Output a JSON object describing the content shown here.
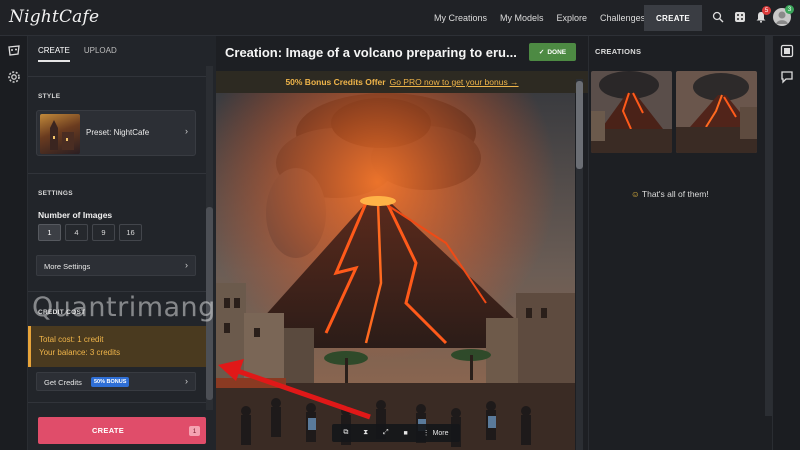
{
  "app": {
    "logo": "NightCafe"
  },
  "topnav": {
    "items": [
      "My Creations",
      "My Models",
      "Explore",
      "Challenges"
    ],
    "create_label": "CREATE",
    "notifications_badge": "5",
    "avatar_badge": "3"
  },
  "left": {
    "tabs": [
      "CREATE",
      "UPLOAD"
    ],
    "style_label": "STYLE",
    "preset_label": "Preset: NightCafe",
    "settings_label": "SETTINGS",
    "num_images_label": "Number of Images",
    "num_options": [
      "1",
      "4",
      "9",
      "16"
    ],
    "selected_num": "1",
    "more_settings": "More Settings",
    "credit_cost_label": "CREDIT COST",
    "total_cost": "Total cost: 1 credit",
    "balance": "Your balance: 3 credits",
    "get_credits": "Get Credits",
    "bonus_badge": "50% BONUS",
    "create_label": "CREATE",
    "create_count": "1"
  },
  "center": {
    "title": "Creation: Image of a volcano preparing to eru...",
    "done_label": "DONE",
    "promo_bold": "50% Bonus Credits Offer",
    "promo_link": "Go PRO now to get your bonus →",
    "toolbar_more": "More"
  },
  "right": {
    "title": "CREATIONS",
    "all_done": "That's all of them!"
  },
  "watermark": "Quantrimang",
  "colors": {
    "accent_create": "#e04d6a",
    "done_green": "#4d8a43",
    "promo_amber": "#f0b54a",
    "bonus_blue": "#2f6fd6"
  }
}
